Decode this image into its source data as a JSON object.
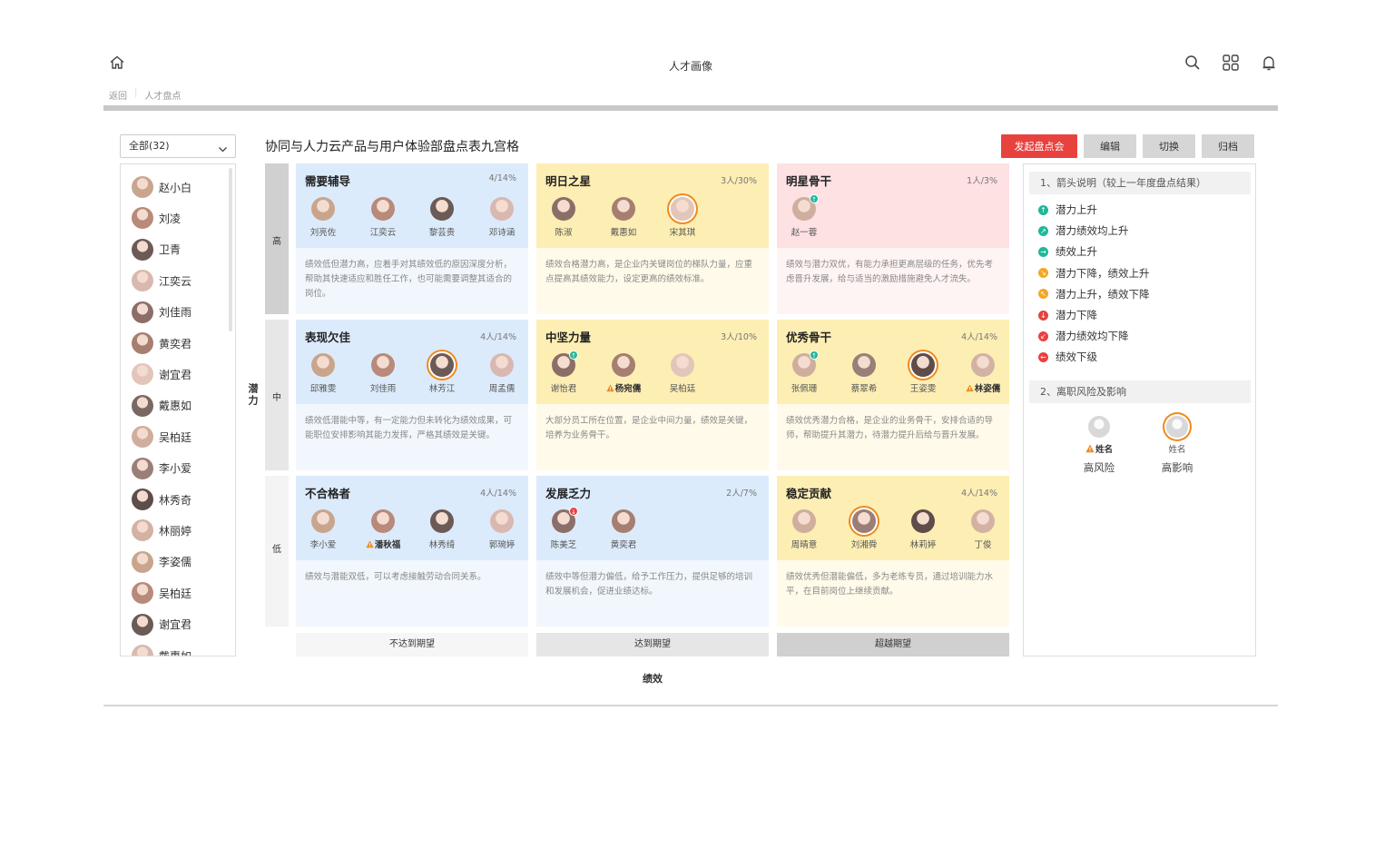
{
  "app": {
    "title": "人才画像"
  },
  "breadcrumb": {
    "back": "返回",
    "current": "人才盘点"
  },
  "filter": {
    "value": "全部(32)"
  },
  "people_list": [
    "赵小白",
    "刘凌",
    "卫青",
    "江奕云",
    "刘佳雨",
    "黄奕君",
    "谢宜君",
    "戴惠如",
    "吴柏廷",
    "李小爱",
    "林秀奇",
    "林丽婷",
    "李姿儒",
    "吴柏廷",
    "谢宜君",
    "戴惠如"
  ],
  "grid_title": "协同与人力云产品与用户体验部盘点表九宫格",
  "actions": {
    "start": "发起盘点会",
    "edit": "编辑",
    "switch": "切换",
    "archive": "归档"
  },
  "colors": {
    "primary": "#e8423f",
    "blue": "#dcebfb",
    "yellow": "#fdeeb4",
    "pink": "#fde1e3",
    "ring": "#f0891f",
    "up": "#1fb79a",
    "mixed": "#f5a623",
    "down": "#e8423f"
  },
  "axis": {
    "y_label": "潜力",
    "y_levels": [
      "高",
      "中",
      "低"
    ],
    "x_label": "绩效",
    "x_levels": [
      "不达到期望",
      "达到期望",
      "超越期望"
    ]
  },
  "cells": [
    {
      "title": "需要辅导",
      "count": "4/14%",
      "desc": "绩效低但潜力高，应着手对其绩效低的原因深度分析，帮助其快速适应和胜任工作，也可能需要调整其适合的岗位。",
      "people": [
        {
          "name": "刘亮佐"
        },
        {
          "name": "江奕云"
        },
        {
          "name": "黎芸贵"
        },
        {
          "name": "邓诗涵"
        }
      ]
    },
    {
      "title": "明日之星",
      "count": "3人/30%",
      "desc": "绩效合格潜力高，是企业内关键岗位的梯队力量，应重点提高其绩效能力，设定更高的绩效标准。",
      "people": [
        {
          "name": "陈淑"
        },
        {
          "name": "戴惠如"
        },
        {
          "name": "宋其琪",
          "ring": true
        }
      ]
    },
    {
      "title": "明星骨干",
      "count": "1人/3%",
      "desc": "绩效与潜力双优，有能力承担更高层级的任务，优先考虑晋升发展，给与适当的激励措施避免人才流失。",
      "people": [
        {
          "name": "赵一蓉",
          "badge": "up"
        }
      ]
    },
    {
      "title": "表现欠佳",
      "count": "4人/14%",
      "desc": "绩效低潜能中等，有一定能力但未转化为绩效成果，可能职位安排影响其能力发挥，严格其绩效是关键。",
      "people": [
        {
          "name": "邱雅雯"
        },
        {
          "name": "刘佳雨"
        },
        {
          "name": "林芳江",
          "ring": true
        },
        {
          "name": "周孟儒"
        }
      ]
    },
    {
      "title": "中坚力量",
      "count": "3人/10%",
      "desc": "大部分员工所在位置，是企业中间力量，绩效是关键，培养为业务骨干。",
      "people": [
        {
          "name": "谢怡君",
          "badge": "up"
        },
        {
          "name": "杨宛儒",
          "warn": true
        },
        {
          "name": "吴柏廷"
        }
      ]
    },
    {
      "title": "优秀骨干",
      "count": "4人/14%",
      "desc": "绩效优秀潜力合格，是企业的业务骨干，安排合适的导师，帮助提升其潜力，待潜力提升后给与晋升发展。",
      "people": [
        {
          "name": "张佩珊",
          "badge": "up"
        },
        {
          "name": "蔡翠希"
        },
        {
          "name": "王姿雯",
          "ring": true
        },
        {
          "name": "林姿儒",
          "warn": true
        }
      ]
    },
    {
      "title": "不合格者",
      "count": "4人/14%",
      "desc": "绩效与潜能双低，可以考虑接触劳动合同关系。",
      "people": [
        {
          "name": "李小爱"
        },
        {
          "name": "潘秋福",
          "warn": true
        },
        {
          "name": "林秀绮"
        },
        {
          "name": "郭琬婷"
        }
      ]
    },
    {
      "title": "发展乏力",
      "count": "2人/7%",
      "desc": "绩效中等但潜力偏低，给予工作压力，提供足够的培训和发展机会，促进业绩达标。",
      "people": [
        {
          "name": "陈美芝",
          "badge": "down"
        },
        {
          "name": "黄奕君"
        }
      ]
    },
    {
      "title": "稳定贡献",
      "count": "4人/14%",
      "desc": "绩效优秀但潜能偏低，多为老练专员，通过培训能力水平，在目前岗位上继续贡献。",
      "people": [
        {
          "name": "周晴意"
        },
        {
          "name": "刘湘舜",
          "ring": true
        },
        {
          "name": "林莉婷"
        },
        {
          "name": "丁俊"
        }
      ]
    }
  ],
  "legend": {
    "section1": "1、箭头说明（较上一年度盘点结果）",
    "arrows": [
      {
        "label": "潜力上升",
        "color": "#1fb79a",
        "glyph": "↑"
      },
      {
        "label": "潜力绩效均上升",
        "color": "#1fb79a",
        "glyph": "↗"
      },
      {
        "label": "绩效上升",
        "color": "#1fb79a",
        "glyph": "→"
      },
      {
        "label": "潜力下降，绩效上升",
        "color": "#f5a623",
        "glyph": "↘"
      },
      {
        "label": "潜力上升，绩效下降",
        "color": "#f5a623",
        "glyph": "↖"
      },
      {
        "label": "潜力下降",
        "color": "#e8423f",
        "glyph": "↓"
      },
      {
        "label": "潜力绩效均下降",
        "color": "#e8423f",
        "glyph": "↙"
      },
      {
        "label": "绩效下级",
        "color": "#e8423f",
        "glyph": "←"
      }
    ],
    "section2": "2、离职风险及影响",
    "risk": [
      {
        "name": "姓名",
        "desc": "高风险",
        "warn": true
      },
      {
        "name": "姓名",
        "desc": "高影响",
        "ring": true
      }
    ]
  }
}
